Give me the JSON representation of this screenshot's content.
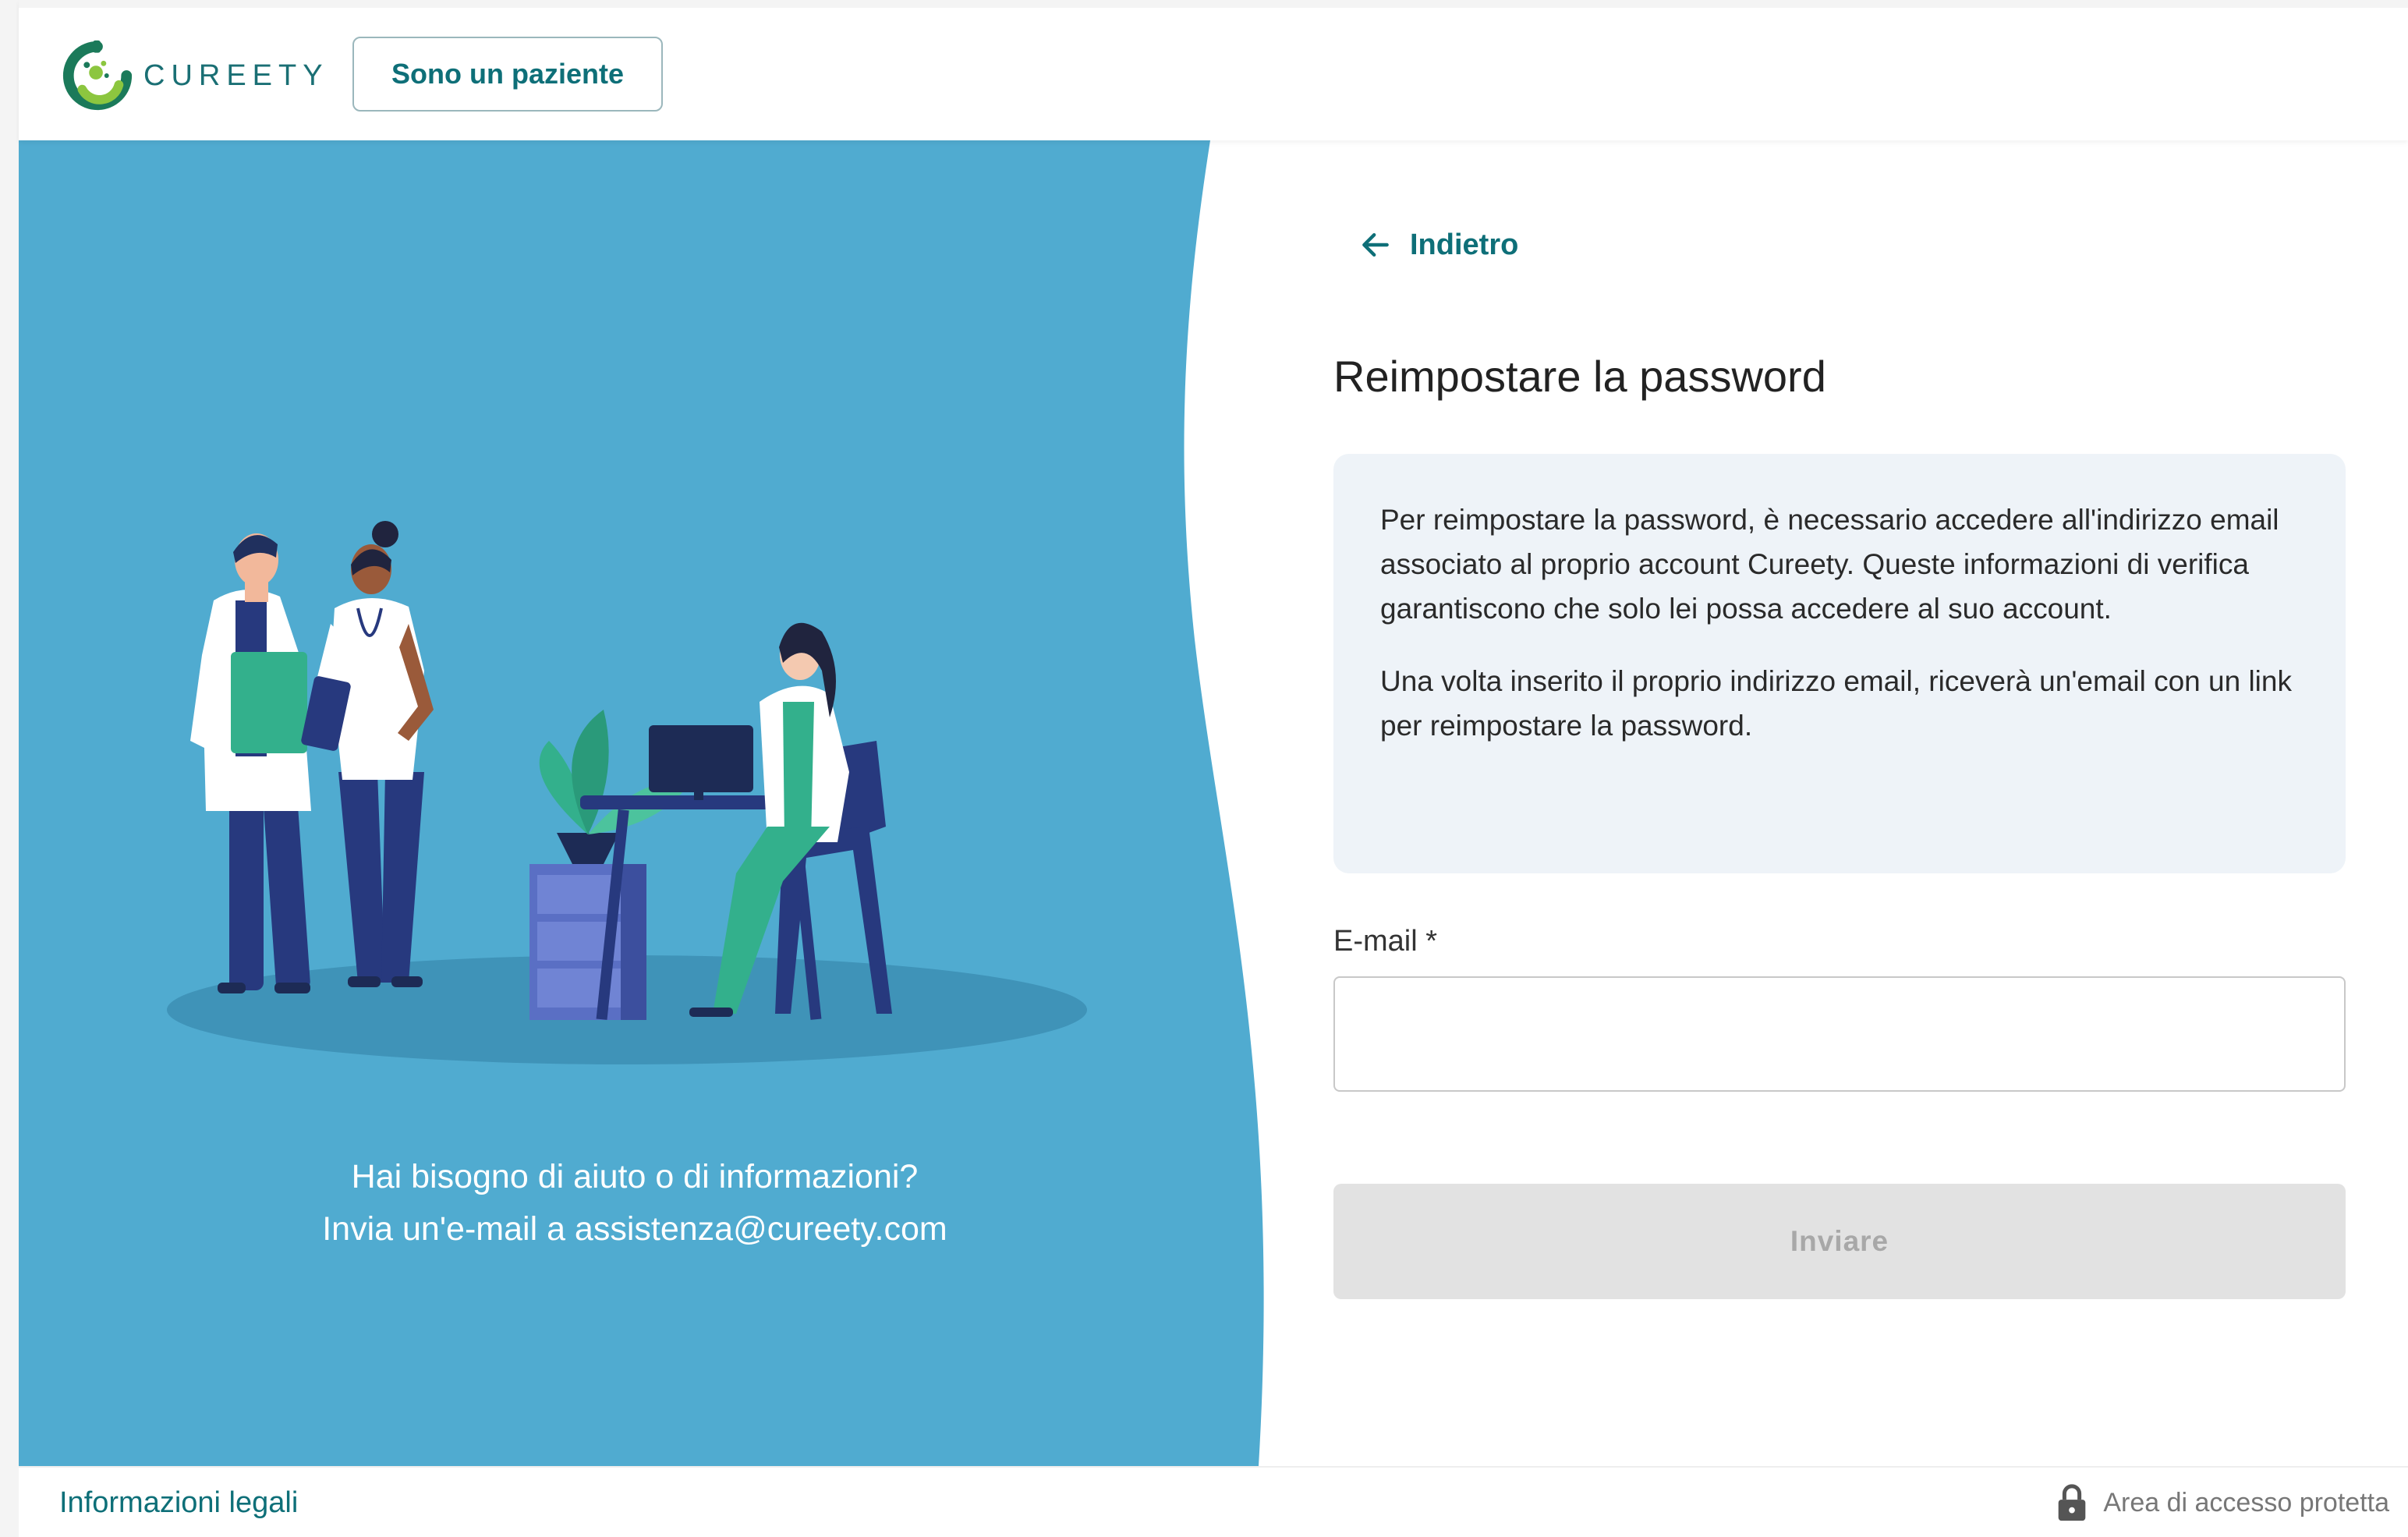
{
  "brand": {
    "logo_text": "CUREETY"
  },
  "header": {
    "patient_button_label": "Sono un paziente"
  },
  "help": {
    "line1": "Hai bisogno di aiuto o di informazioni?",
    "line2": "Invia un'e-mail a assistenza@cureety.com"
  },
  "form": {
    "back_label": "Indietro",
    "title": "Reimpostare la password",
    "info_paragraph_1": "Per reimpostare la password, è necessario accedere all'indirizzo email associato al proprio account Cureety. Queste informazioni di verifica garantiscono che solo lei possa accedere al suo account.",
    "info_paragraph_2": "Una volta inserito il proprio indirizzo email, riceverà un'email con un link per reimpostare la password.",
    "email_label": "E-mail *",
    "email_value": "",
    "submit_label": "Inviare"
  },
  "footer": {
    "legal_label": "Informazioni legali",
    "secure_label": "Area di accesso protetta"
  },
  "colors": {
    "brand_teal": "#0e6f78",
    "panel_blue": "#50abd0",
    "info_bg": "#eef3f8",
    "disabled_button_bg": "#e2e2e2"
  },
  "icons": {
    "back": "arrow-left-icon",
    "lock": "lock-icon",
    "logo": "cureety-logo-icon"
  }
}
